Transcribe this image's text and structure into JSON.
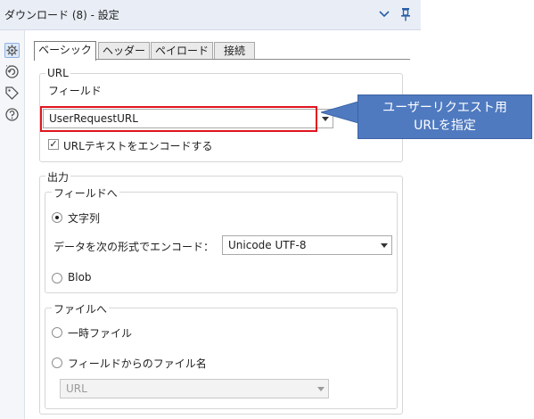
{
  "header": {
    "title": "ダウンロード (8) - 設定"
  },
  "tabs": [
    {
      "label": "ベーシック",
      "active": true
    },
    {
      "label": "ヘッダー",
      "active": false
    },
    {
      "label": "ペイロード",
      "active": false
    },
    {
      "label": "接続",
      "active": false
    }
  ],
  "url_section": {
    "group_label": "URL",
    "field_label": "フィールド",
    "field_value": "UserRequestURL",
    "encode_checkbox_label": "URLテキストをエンコードする",
    "encode_checked": true
  },
  "output_section": {
    "group_label": "出力",
    "to_field_group": {
      "label": "フィールドへ",
      "string_radio_label": "文字列",
      "string_selected": true,
      "encode_label": "データを次の形式でエンコード：",
      "encode_value": "Unicode UTF-8",
      "blob_radio_label": "Blob",
      "blob_selected": false
    },
    "to_file_group": {
      "label": "ファイルへ",
      "temp_file_label": "一時ファイル",
      "temp_selected": false,
      "filename_from_field_label": "フィールドからのファイル名",
      "filename_selected": false,
      "filename_field_value": "URL"
    }
  },
  "callout": {
    "line1": "ユーザーリクエスト用",
    "line2": "URLを指定"
  },
  "colors": {
    "highlight_border": "#e0141e",
    "callout_fill": "#4f7ac0",
    "title_bar": "#e9eef6"
  }
}
